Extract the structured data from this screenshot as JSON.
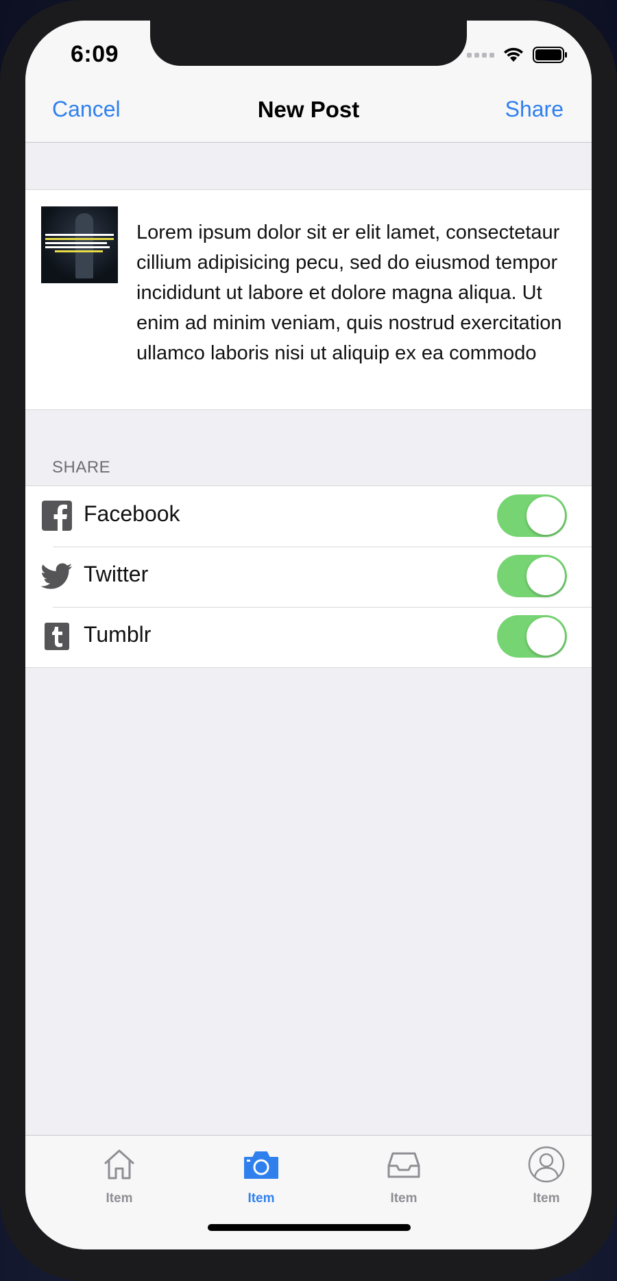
{
  "status_bar": {
    "time": "6:09"
  },
  "nav": {
    "cancel_label": "Cancel",
    "title": "New Post",
    "share_label": "Share"
  },
  "post": {
    "caption": "Lorem ipsum dolor sit er elit lamet, consectetaur cillium adipisicing pecu, sed do eiusmod tempor incididunt ut labore et dolore magna aliqua. Ut enim ad minim veniam, quis nostrud exercitation ullamco laboris nisi ut aliquip ex ea commodo"
  },
  "share_section": {
    "header": "SHARE",
    "items": [
      {
        "label": "Facebook",
        "icon": "facebook-icon",
        "enabled": true
      },
      {
        "label": "Twitter",
        "icon": "twitter-icon",
        "enabled": true
      },
      {
        "label": "Tumblr",
        "icon": "tumblr-icon",
        "enabled": true
      }
    ]
  },
  "tabbar": {
    "items": [
      {
        "label": "Item",
        "icon": "home-icon",
        "active": false
      },
      {
        "label": "Item",
        "icon": "camera-icon",
        "active": true
      },
      {
        "label": "Item",
        "icon": "inbox-icon",
        "active": false
      },
      {
        "label": "Item",
        "icon": "profile-icon",
        "active": false
      }
    ]
  },
  "colors": {
    "accent": "#2f80ed",
    "toggle_on": "#76d572",
    "background": "#efeff4"
  }
}
